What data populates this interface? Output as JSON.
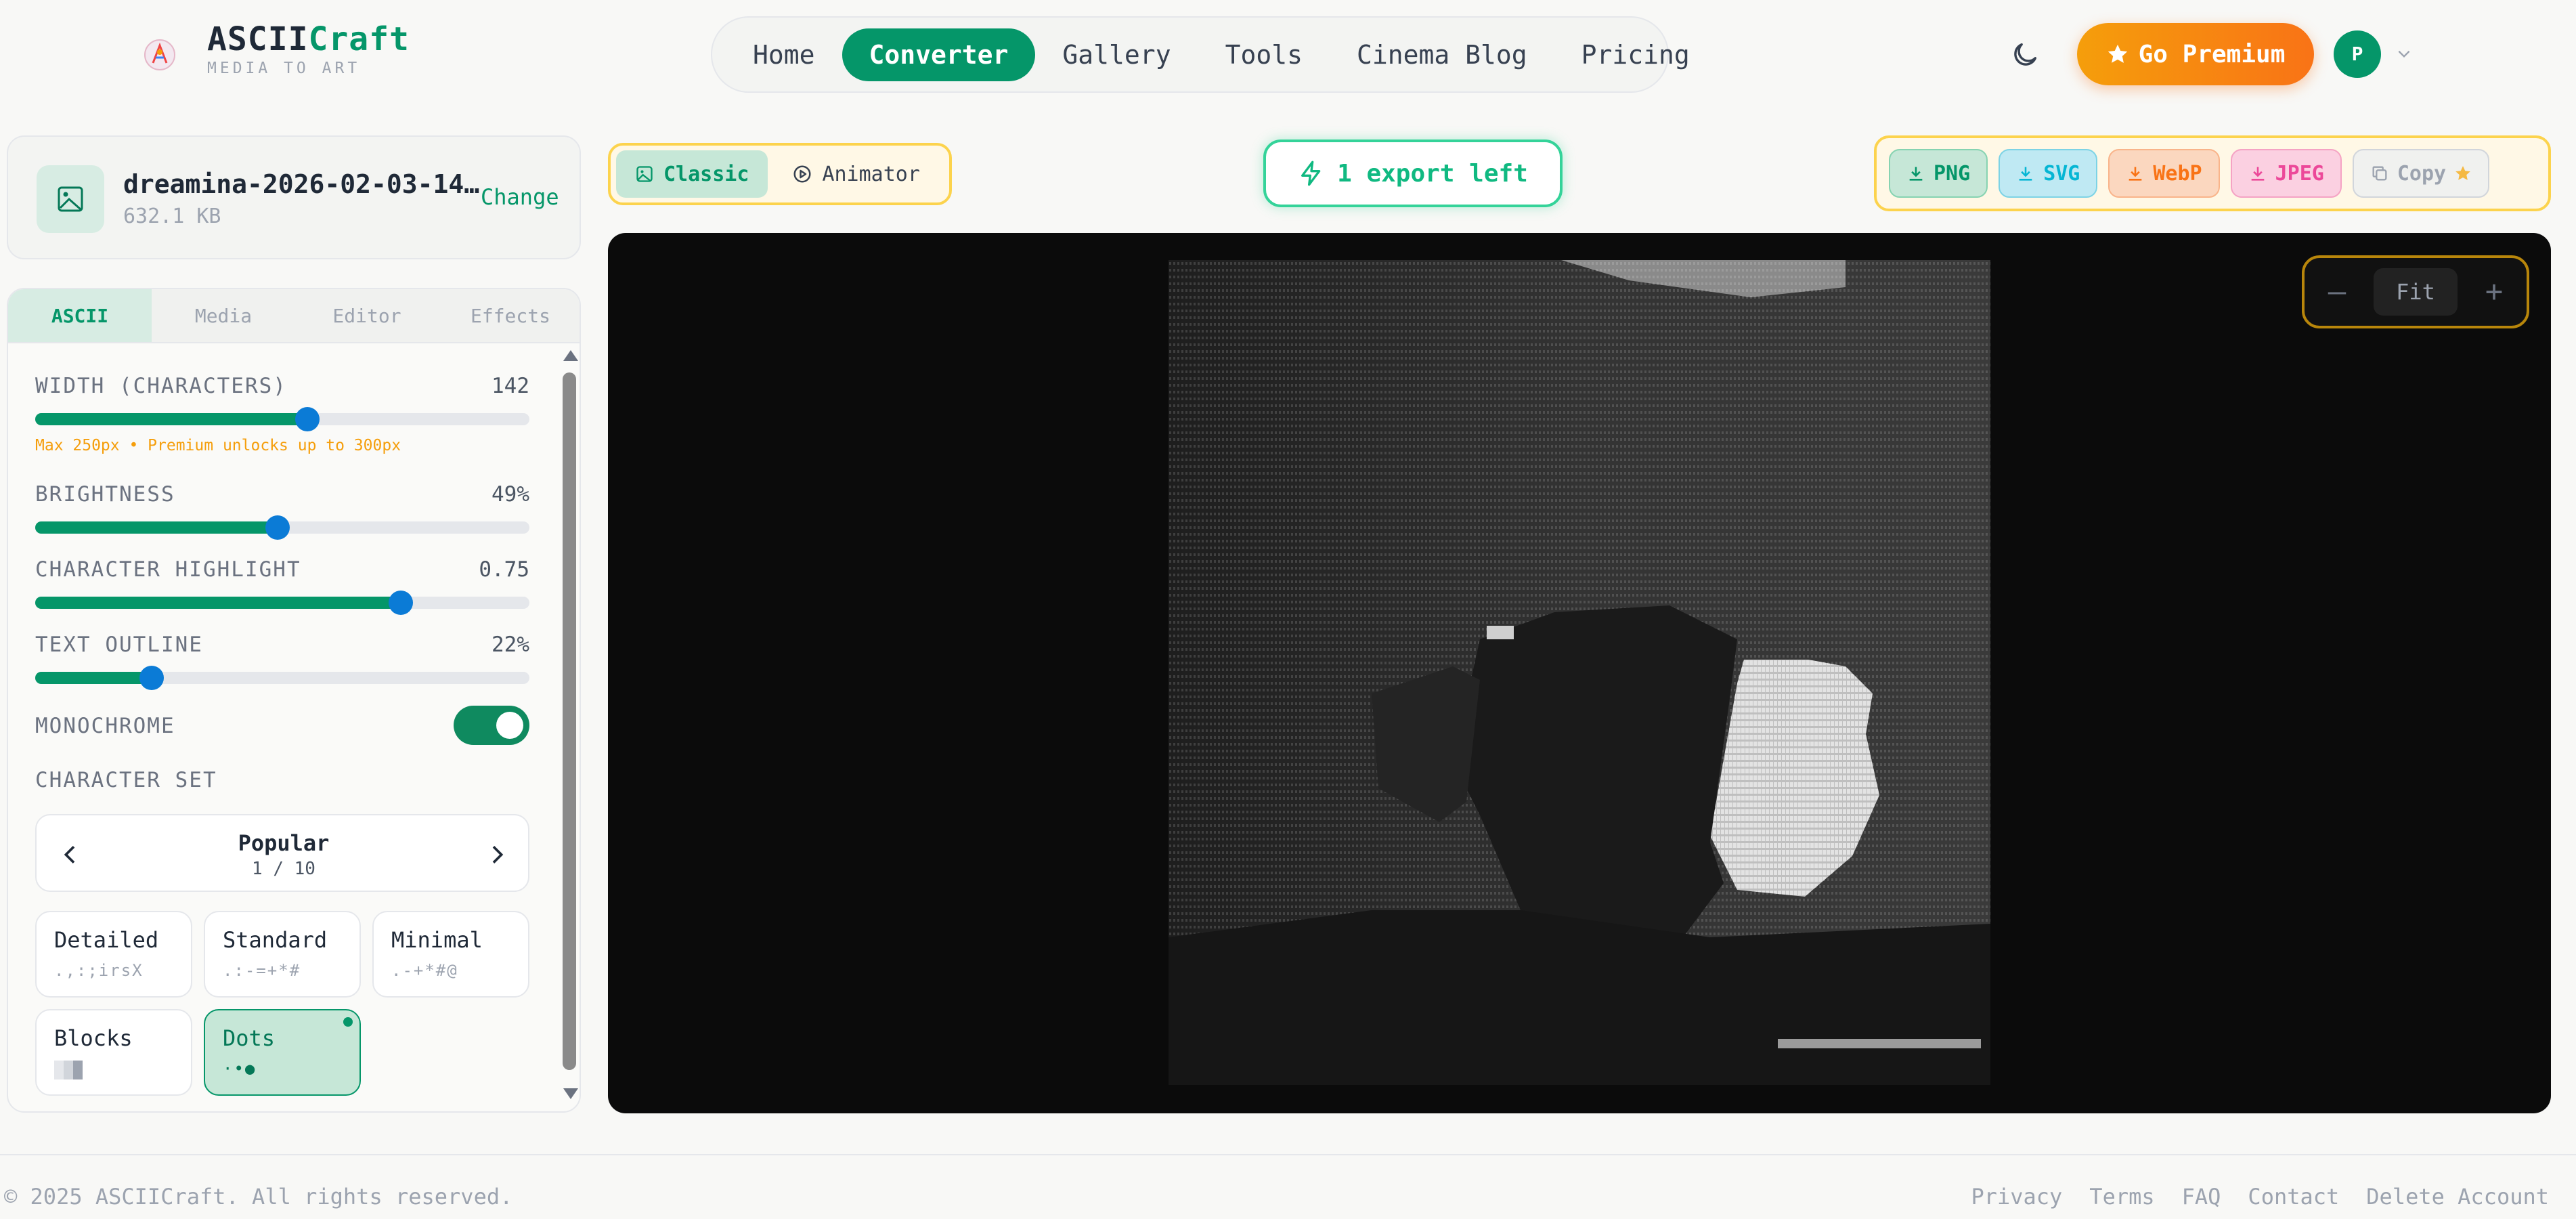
{
  "brand": {
    "name_part1": "ASCII",
    "name_part2": "Craft",
    "tagline": "MEDIA TO ART"
  },
  "nav": {
    "items": [
      "Home",
      "Converter",
      "Gallery",
      "Tools",
      "Cinema Blog",
      "Pricing"
    ],
    "active": "Converter"
  },
  "header": {
    "premium_label": "Go Premium",
    "avatar_initial": "P"
  },
  "file": {
    "name": "dreamina-2026-02-03-14…",
    "size": "632.1 KB",
    "change_label": "Change"
  },
  "panel_tabs": [
    "ASCII",
    "Media",
    "Editor",
    "Effects"
  ],
  "controls": {
    "width": {
      "label": "WIDTH (CHARACTERS)",
      "value": "142",
      "fraction": 0.55,
      "hint": "Max 250px • Premium unlocks up to 300px"
    },
    "brightness": {
      "label": "BRIGHTNESS",
      "value": "49%",
      "fraction": 0.49
    },
    "highlight": {
      "label": "CHARACTER HIGHLIGHT",
      "value": "0.75",
      "fraction": 0.74
    },
    "outline": {
      "label": "TEXT OUTLINE",
      "value": "22%",
      "fraction": 0.235
    },
    "monochrome": {
      "label": "MONOCHROME",
      "on": true
    },
    "charset_label": "CHARACTER SET"
  },
  "charset": {
    "category": "Popular",
    "page": "1 / 10",
    "cards": [
      {
        "name": "Detailed",
        "sample": ".,:;irsX"
      },
      {
        "name": "Standard",
        "sample": ".:-=+*#"
      },
      {
        "name": "Minimal",
        "sample": ".-+*#@"
      },
      {
        "name": "Blocks",
        "sample": ""
      },
      {
        "name": "Dots",
        "sample": "·•●"
      }
    ],
    "selected": "Dots"
  },
  "modes": {
    "classic": "Classic",
    "animator": "Animator"
  },
  "export_badge": "1 export left",
  "exports": {
    "png": "PNG",
    "svg": "SVG",
    "webp": "WebP",
    "jpeg": "JPEG",
    "copy": "Copy"
  },
  "zoom": {
    "fit_label": "Fit"
  },
  "footer": {
    "copyright": "© 2025 ASCIICraft. All rights reserved.",
    "links": [
      "Privacy",
      "Terms",
      "FAQ",
      "Contact",
      "Delete Account"
    ]
  },
  "colors": {
    "accent": "#059669",
    "premium": "#f97316",
    "thumb": "#0b7bd6"
  }
}
